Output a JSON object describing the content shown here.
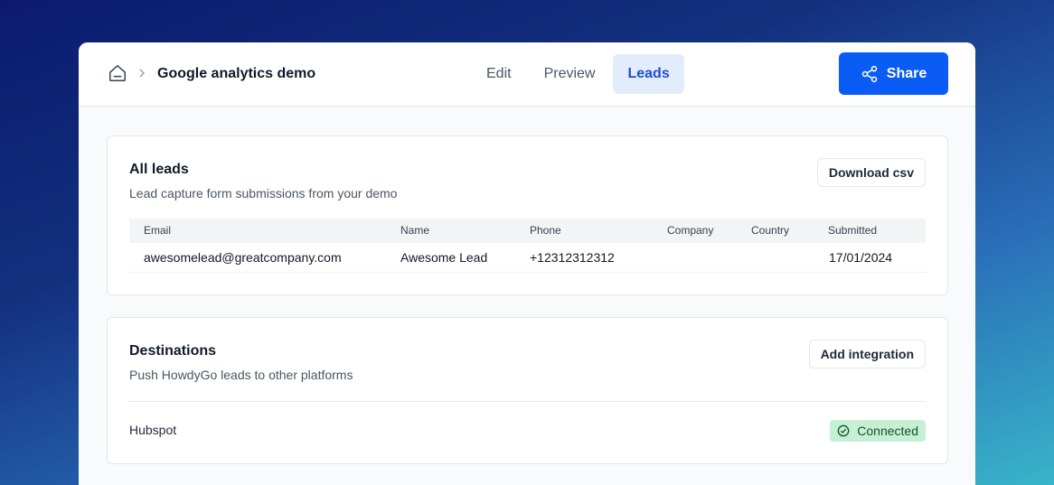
{
  "header": {
    "demo_title": "Google analytics demo",
    "tabs": [
      {
        "label": "Edit",
        "active": false
      },
      {
        "label": "Preview",
        "active": false
      },
      {
        "label": "Leads",
        "active": true
      }
    ],
    "share_label": "Share"
  },
  "leads": {
    "title": "All leads",
    "subtitle": "Lead capture form submissions from your demo",
    "download_label": "Download csv",
    "columns": [
      "Email",
      "Name",
      "Phone",
      "Company",
      "Country",
      "Submitted"
    ],
    "rows": [
      [
        "awesomelead@greatcompany.com",
        "Awesome Lead",
        "+12312312312",
        "",
        "",
        "17/01/2024"
      ]
    ]
  },
  "destinations": {
    "title": "Destinations",
    "subtitle": "Push HowdyGo leads to other platforms",
    "add_label": "Add integration",
    "items": [
      {
        "name": "Hubspot",
        "status": "Connected"
      }
    ]
  },
  "colors": {
    "accent": "#0a5cf5",
    "active_tab_bg": "#e3ecfb",
    "connected_bg": "#c6f0d4"
  },
  "icons": [
    "home-icon",
    "chevron-right-icon",
    "share-icon",
    "check-circle-icon"
  ]
}
